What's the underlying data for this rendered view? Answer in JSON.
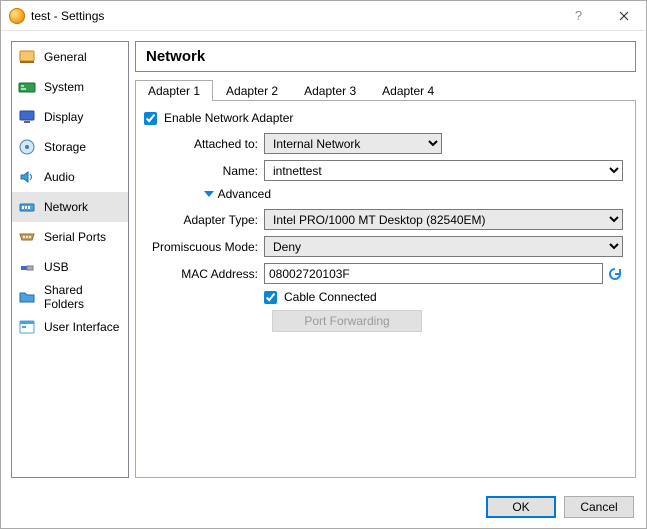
{
  "window": {
    "title": "test - Settings"
  },
  "sidebar": {
    "items": [
      {
        "label": "General"
      },
      {
        "label": "System"
      },
      {
        "label": "Display"
      },
      {
        "label": "Storage"
      },
      {
        "label": "Audio"
      },
      {
        "label": "Network"
      },
      {
        "label": "Serial Ports"
      },
      {
        "label": "USB"
      },
      {
        "label": "Shared Folders"
      },
      {
        "label": "User Interface"
      }
    ]
  },
  "header": {
    "title": "Network"
  },
  "tabs": [
    {
      "label": "Adapter 1"
    },
    {
      "label": "Adapter 2"
    },
    {
      "label": "Adapter 3"
    },
    {
      "label": "Adapter 4"
    }
  ],
  "form": {
    "enable_label": "Enable Network Adapter",
    "enable_checked": true,
    "attached_label": "Attached to:",
    "attached_value": "Internal Network",
    "name_label": "Name:",
    "name_value": "intnettest",
    "advanced_label": "Advanced",
    "adapter_type_label": "Adapter Type:",
    "adapter_type_value": "Intel PRO/1000 MT Desktop (82540EM)",
    "promiscuous_label": "Promiscuous Mode:",
    "promiscuous_value": "Deny",
    "mac_label": "MAC Address:",
    "mac_value": "08002720103F",
    "cable_label": "Cable Connected",
    "cable_checked": true,
    "port_fwd_label": "Port Forwarding"
  },
  "footer": {
    "ok": "OK",
    "cancel": "Cancel"
  }
}
